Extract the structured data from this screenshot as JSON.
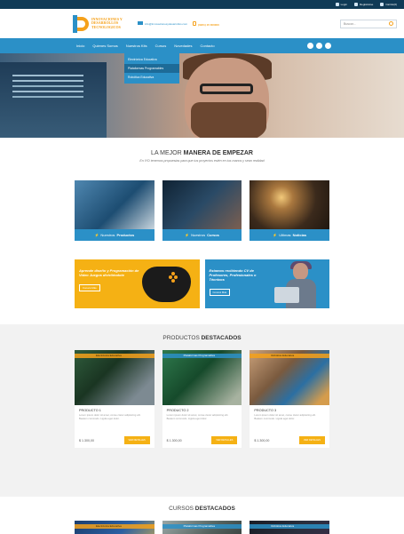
{
  "topbar": {
    "items": [
      "Login",
      "Registrarse",
      "Carrito(0)"
    ]
  },
  "header": {
    "logo_text": "INNOVACIONES Y DESARROLLOS TECNOLOGICOS",
    "email": "info@innovacionesydesarrollos.com",
    "phone": "(0221) 15 000000",
    "search_placeholder": "Buscar..."
  },
  "nav": {
    "items": [
      "Inicio",
      "Quienes Somos",
      "Nuestros Kits",
      "Cursos",
      "Novedades",
      "Contacto"
    ]
  },
  "dropdown": {
    "items": [
      "Electrónica Educativa",
      "Plataformas Programables",
      "Robótica Educativa"
    ]
  },
  "intro": {
    "title_pre": "LA MEJOR ",
    "title_bold": "MANERA DE EMPEZAR",
    "subtitle": "En IYD tenemos propuestas para que tus proyectos estén en tus manos y sean realidad"
  },
  "categories": [
    {
      "pre": "Nuestros ",
      "bold": "Productos"
    },
    {
      "pre": "Nuestros ",
      "bold": "Cursos"
    },
    {
      "pre": "Ultimas ",
      "bold": "Noticias"
    }
  ],
  "banners": [
    {
      "text": "Aprende diseño y Programación de Video Juegos divirtiéndote",
      "button": "Conocé Más"
    },
    {
      "text": "Estamos recibiendo CV de Profesores, Profesionales o Técnicos",
      "button": "Conocé Más"
    }
  ],
  "products": {
    "title_pre": "PRODUCTOS ",
    "title_bold": "DESTACADOS",
    "items": [
      {
        "tag": "Electrónica Educativa",
        "name": "PRODUCTO 1",
        "desc": "Lorem ipsum dolor sit amet, conse ctetur adipisicing elit. Beatem commodo. Ligula eget dolor.",
        "price": "$ 1.300,00",
        "button": "VER DETALLES"
      },
      {
        "tag": "Plataformas Programables",
        "name": "PRODUCTO 2",
        "desc": "Lorem ipsum dolor sit amet, conse ctetur adipisicing elit. Beatem commodo. Ligula eget dolor.",
        "price": "$ 1.300,00",
        "button": "VER DETALLES"
      },
      {
        "tag": "Robótica Educativa",
        "name": "PRODUCTO 3",
        "desc": "Lorem ipsum dolor sit amet, conse ctetur adipisicing elit. Beatem commodo. Ligula eget dolor.",
        "price": "$ 1.300,00",
        "button": "VER DETALLES"
      }
    ]
  },
  "courses": {
    "title_pre": "CURSOS ",
    "title_bold": "DESTACADOS",
    "tags": [
      "Electrónica Educativa",
      "Plataformas Programables",
      "Robótica Educativa"
    ]
  },
  "colors": {
    "primary": "#2b90c7",
    "accent": "#f5a11b",
    "dark": "#0f3a56"
  }
}
